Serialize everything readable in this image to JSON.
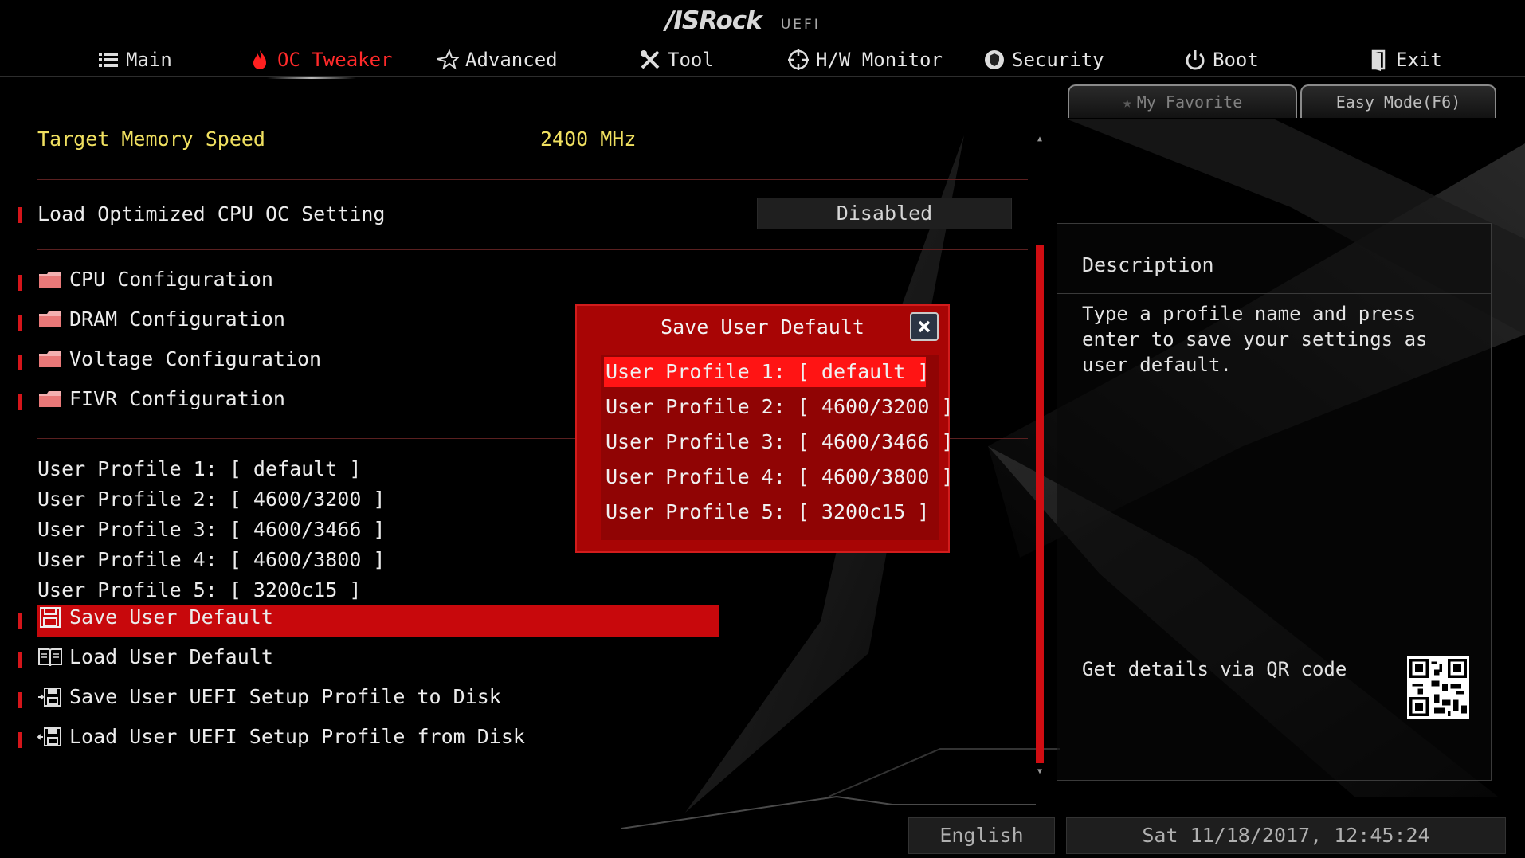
{
  "header": {
    "brand": "/ISRock",
    "brand_sub": "UEFI",
    "tabs": [
      {
        "label": "Main",
        "icon": "list-icon"
      },
      {
        "label": "OC Tweaker",
        "icon": "flame-icon",
        "active": true
      },
      {
        "label": "Advanced",
        "icon": "star-icon"
      },
      {
        "label": "Tool",
        "icon": "tools-icon"
      },
      {
        "label": "H/W Monitor",
        "icon": "monitor-icon"
      },
      {
        "label": "Security",
        "icon": "shield-icon"
      },
      {
        "label": "Boot",
        "icon": "power-icon"
      },
      {
        "label": "Exit",
        "icon": "exit-door-icon"
      }
    ],
    "favorite_label": "My Favorite",
    "easy_mode_label": "Easy Mode(F6)"
  },
  "main": {
    "target_memory_label": "Target Memory Speed",
    "target_memory_value": "2400 MHz",
    "load_optimized_label": "Load Optimized CPU OC Setting",
    "load_optimized_value": "Disabled",
    "folders": [
      "CPU Configuration",
      "DRAM Configuration",
      "Voltage Configuration",
      "FIVR Configuration"
    ],
    "profiles": [
      "User Profile 1: [ default ]",
      "User Profile 2: [ 4600/3200 ]",
      "User Profile 3: [ 4600/3466 ]",
      "User Profile 4: [ 4600/3800 ]",
      "User Profile 5: [ 3200c15 ]"
    ],
    "actions": [
      "Save User Default",
      "Load User Default",
      "Save User UEFI Setup Profile to Disk",
      "Load User UEFI Setup Profile from Disk"
    ]
  },
  "description": {
    "title": "Description",
    "text": "Type a profile name and press enter to save your settings as user default.",
    "qr_label": "Get details via QR code"
  },
  "modal": {
    "title": "Save User Default",
    "items": [
      "User Profile 1: [ default ]",
      "User Profile 2: [ 4600/3200 ]",
      "User Profile 3: [ 4600/3466 ]",
      "User Profile 4: [ 4600/3800 ]",
      "User Profile 5: [ 3200c15 ]"
    ],
    "selected_index": 0
  },
  "footer": {
    "language": "English",
    "datetime": "Sat 11/18/2017, 12:45:24"
  },
  "colors": {
    "accent": "#d00d12",
    "highlight": "#ff1414",
    "title_yellow": "#f0e060",
    "background": "#000000"
  }
}
